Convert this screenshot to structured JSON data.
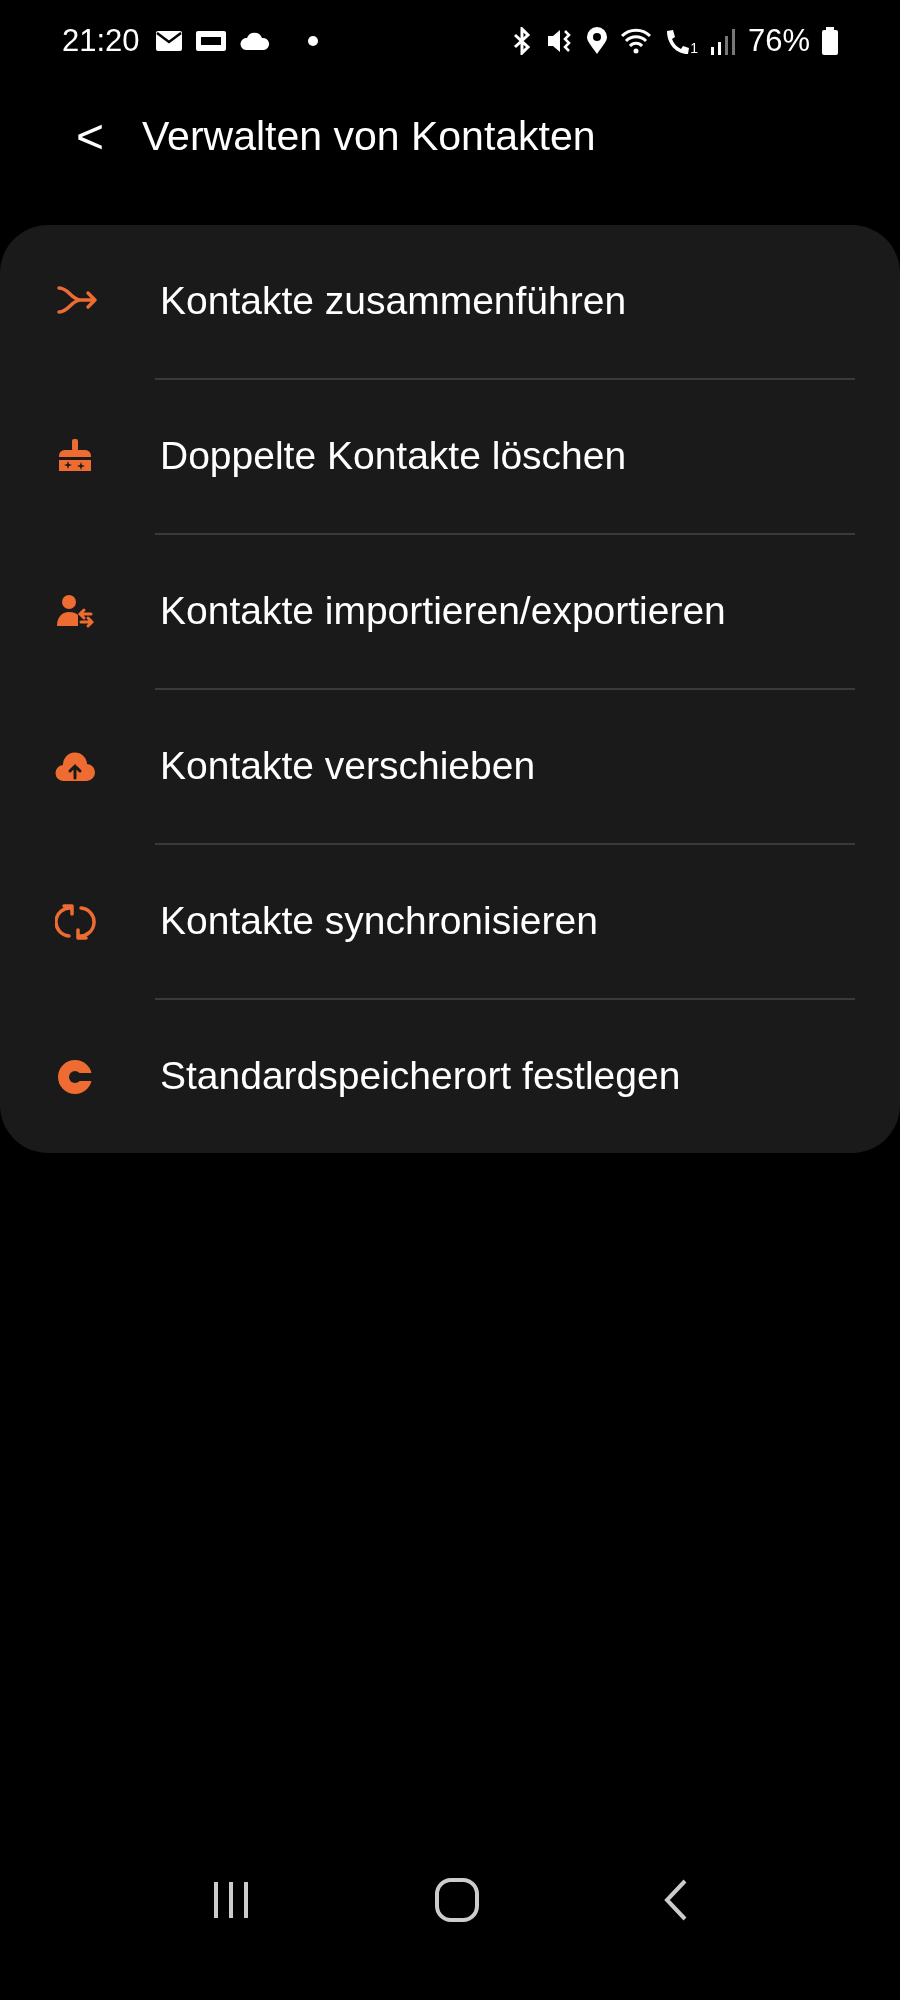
{
  "status_bar": {
    "time": "21:20",
    "sim_label": "1",
    "battery": "76%"
  },
  "header": {
    "back": "<",
    "title": "Verwalten von Kontakten"
  },
  "menu": [
    {
      "kind": "merge",
      "label": "Kontakte zusammenführen"
    },
    {
      "kind": "clean",
      "label": "Doppelte Kontakte löschen"
    },
    {
      "kind": "importexport",
      "label": "Kontakte importieren/exportieren"
    },
    {
      "kind": "upload",
      "label": "Kontakte verschieben"
    },
    {
      "kind": "sync",
      "label": "Kontakte synchronisieren"
    },
    {
      "kind": "storage",
      "label": "Standardspeicherort festlegen"
    }
  ]
}
